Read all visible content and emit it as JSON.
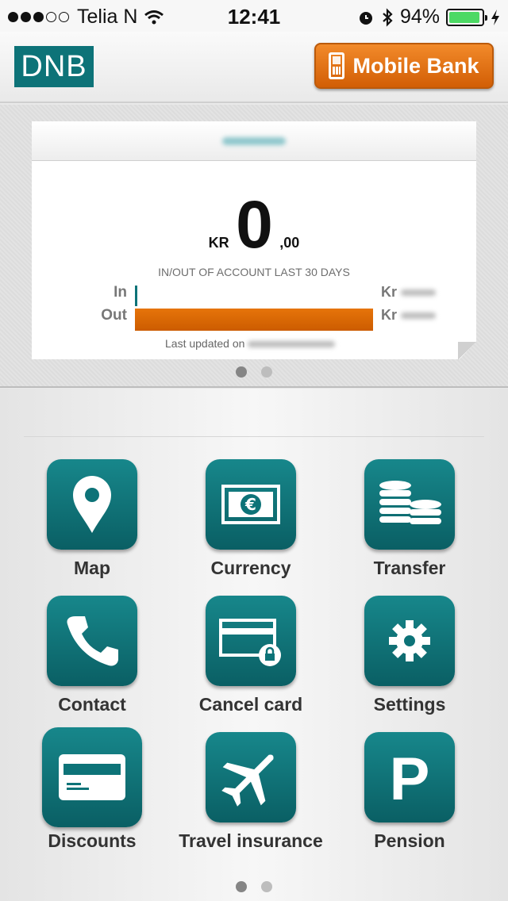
{
  "status_bar": {
    "carrier": "Telia N",
    "time": "12:41",
    "battery": "94%",
    "battery_level": 0.94
  },
  "header": {
    "logo": "DNB",
    "mobile_bank_label": "Mobile Bank"
  },
  "account": {
    "currency": "KR",
    "balance_int": "0",
    "balance_dec": ",00",
    "io_title": "IN/OUT OF ACCOUNT LAST 30 DAYS",
    "in_label": "In",
    "out_label": "Out",
    "in_amount_prefix": "Kr",
    "out_amount_prefix": "Kr",
    "last_updated_label": "Last updated on"
  },
  "menu": {
    "items": [
      {
        "label": "Map",
        "icon": "map-pin-icon"
      },
      {
        "label": "Currency",
        "icon": "currency-icon"
      },
      {
        "label": "Transfer",
        "icon": "coins-icon"
      },
      {
        "label": "Contact",
        "icon": "phone-icon"
      },
      {
        "label": "Cancel card",
        "icon": "card-lock-icon"
      },
      {
        "label": "Settings",
        "icon": "gear-icon"
      },
      {
        "label": "Discounts",
        "icon": "card-icon"
      },
      {
        "label": "Travel insurance",
        "icon": "plane-icon"
      },
      {
        "label": "Pension",
        "icon": "parking-p-icon"
      }
    ]
  },
  "colors": {
    "teal": "#0d7378",
    "orange": "#e06a0a"
  }
}
